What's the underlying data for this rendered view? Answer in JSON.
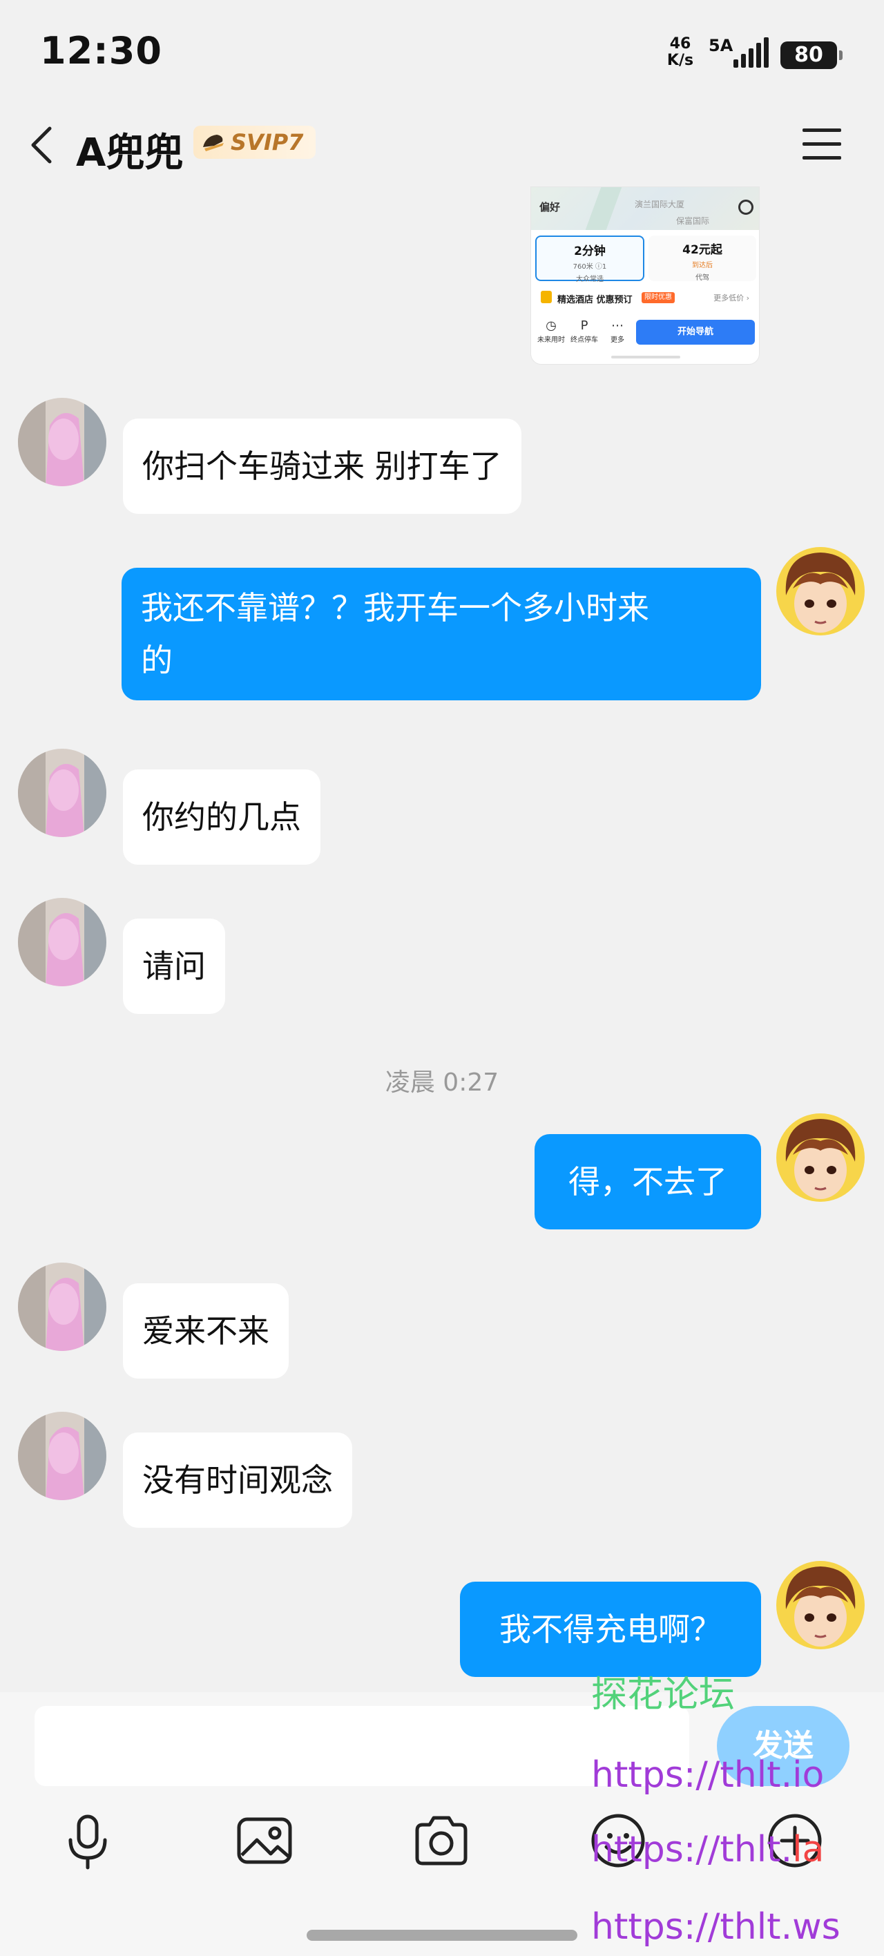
{
  "status_bar": {
    "time": "12:30",
    "net_speed_value": "46",
    "net_speed_unit": "K/s",
    "network": "5A",
    "battery": "80"
  },
  "header": {
    "title": "A兜兜",
    "badge": "SVIP7"
  },
  "map_card": {
    "preference": "偏好",
    "poi_1": "演兰国际大厦",
    "poi_2": "保富国际",
    "route_a_main": "2分钟",
    "route_a_sub1": "760米 ⓘ1",
    "route_a_sub2": "大众常选",
    "route_b_main": "42元起",
    "route_b_sub1": "到达后",
    "route_b_sub2": "代驾",
    "hotel_label": "精选酒店 优惠预订",
    "hotel_tag": "限时优惠",
    "hotel_more": "更多低价 ›",
    "tool_1": "未来用时",
    "tool_2": "终点停车",
    "tool_3": "更多",
    "start_button": "开始导航"
  },
  "messages": [
    {
      "side": "in",
      "text": "你扫个车骑过来 别打车了"
    },
    {
      "side": "out",
      "line1": "我还不靠谱？？我开车一个多小时来",
      "line2": "的"
    },
    {
      "side": "in",
      "text": "你约的几点"
    },
    {
      "side": "in",
      "text": "请问"
    },
    {
      "side": "divider",
      "text": "凌晨 0:27"
    },
    {
      "side": "out",
      "text": "得，不去了"
    },
    {
      "side": "in",
      "text": "爱来不来"
    },
    {
      "side": "in",
      "text": "没有时间观念"
    },
    {
      "side": "out",
      "text": "我不得充电啊？"
    }
  ],
  "input_bar": {
    "placeholder": "",
    "send_label": "发送"
  },
  "toolbar_icons": [
    "microphone-icon",
    "image-icon",
    "camera-icon",
    "emoji-icon",
    "plus-icon"
  ],
  "watermark": {
    "line1": "探花论坛",
    "line2": "https://thlt.io",
    "line3a": "https://thlt.",
    "line3b": "la",
    "line4": "https://thlt.ws"
  },
  "colors": {
    "background": "#f1f1f1",
    "outgoing_bubble": "#0a99ff",
    "incoming_bubble": "#ffffff",
    "send_button": "#8fd0ff",
    "badge_text": "#b8762a"
  }
}
